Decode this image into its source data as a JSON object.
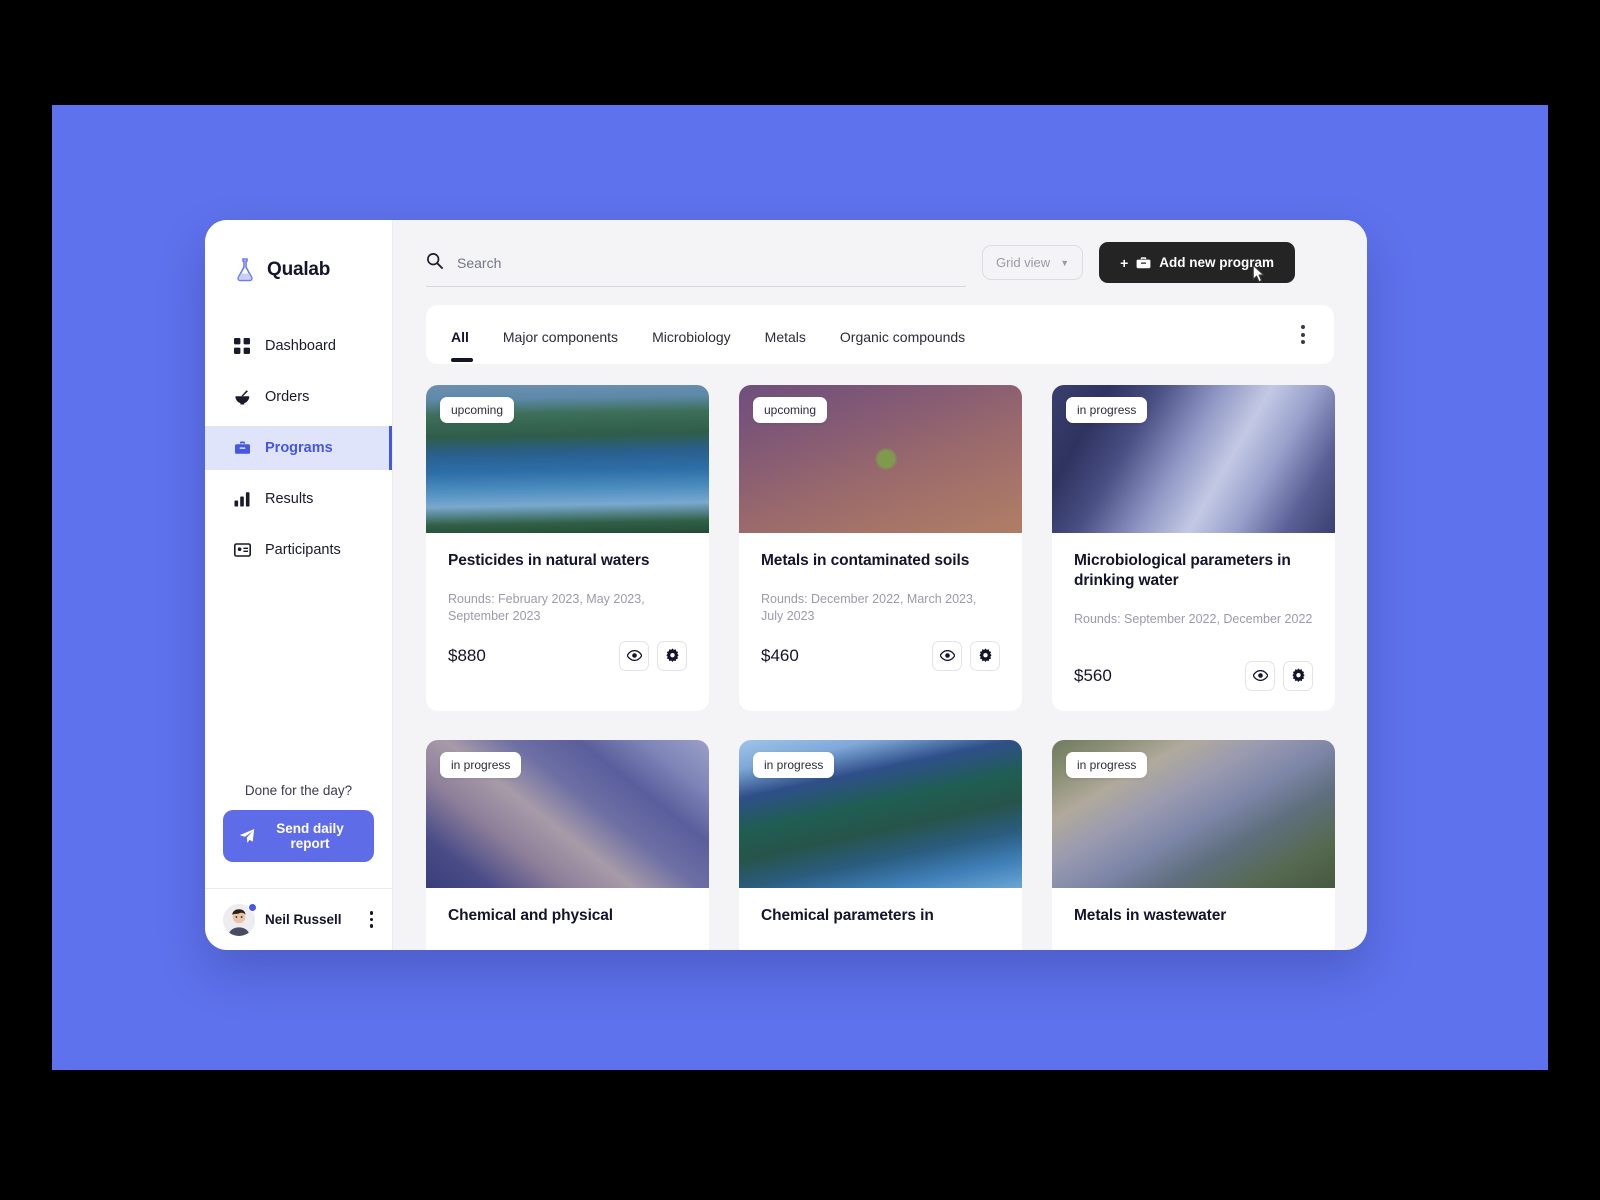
{
  "theme": {
    "backdrop_color": "#5E72ED",
    "accent_color": "#4557E4",
    "button_primary_color": "#5E6CE8",
    "dark_button_color": "#242424",
    "canvas_color": "#F4F4F6"
  },
  "sidebar": {
    "brand": {
      "name": "Qualab",
      "icon": "flask-icon"
    },
    "items": [
      {
        "label": "Dashboard",
        "icon": "dashboard-grid-icon",
        "active": false
      },
      {
        "label": "Orders",
        "icon": "mortar-pestle-icon",
        "active": false
      },
      {
        "label": "Programs",
        "icon": "briefcase-icon",
        "active": true
      },
      {
        "label": "Results",
        "icon": "bar-chart-icon",
        "active": false
      },
      {
        "label": "Participants",
        "icon": "id-card-icon",
        "active": false
      }
    ],
    "daily": {
      "question": "Done for the day?",
      "button_label": "Send daily report",
      "button_icon": "paper-plane-icon"
    },
    "user": {
      "name": "Neil Russell",
      "menu_icon": "kebab-menu-icon",
      "status": "online"
    }
  },
  "topbar": {
    "search": {
      "placeholder": "Search",
      "value": "",
      "icon": "search-icon"
    },
    "view_select": {
      "label": "Grid view",
      "icon": "chevron-down-icon"
    },
    "add_button": {
      "label": "Add new program",
      "plus": "+",
      "icon": "basket-icon"
    }
  },
  "tabs": {
    "items": [
      {
        "label": "All",
        "active": true
      },
      {
        "label": "Major components",
        "active": false
      },
      {
        "label": "Microbiology",
        "active": false
      },
      {
        "label": "Metals",
        "active": false
      },
      {
        "label": "Organic compounds",
        "active": false
      }
    ],
    "overflow_icon": "kebab-menu-icon"
  },
  "programs": [
    {
      "status": "upcoming",
      "title": "Pesticides in natural waters",
      "rounds": "Rounds: February 2023, May 2023, September 2023",
      "price": "$880",
      "image": "lake-forest-reflection",
      "view_icon": "eye-icon",
      "settings_icon": "gear-icon"
    },
    {
      "status": "upcoming",
      "title": "Metals in contaminated soils",
      "rounds": "Rounds: December 2022, March 2023, July 2023",
      "price": "$460",
      "image": "soil-with-green-leaf",
      "view_icon": "eye-icon",
      "settings_icon": "gear-icon"
    },
    {
      "status": "in progress",
      "title": "Microbiological parameters in drinking water",
      "rounds": "Rounds: September 2022,  December 2022",
      "price": "$560",
      "image": "tap-water-splash",
      "view_icon": "eye-icon",
      "settings_icon": "gear-icon"
    },
    {
      "status": "in progress",
      "title": "Chemical and physical",
      "rounds": "",
      "price": "",
      "image": "wastewater-treatment-aerial",
      "view_icon": "eye-icon",
      "settings_icon": "gear-icon"
    },
    {
      "status": "in progress",
      "title": "Chemical parameters in",
      "rounds": "",
      "price": "",
      "image": "river-valley-forest",
      "view_icon": "eye-icon",
      "settings_icon": "gear-icon"
    },
    {
      "status": "in progress",
      "title": "Metals in wastewater",
      "rounds": "",
      "price": "",
      "image": "treatment-plant-aerial",
      "view_icon": "eye-icon",
      "settings_icon": "gear-icon"
    }
  ]
}
